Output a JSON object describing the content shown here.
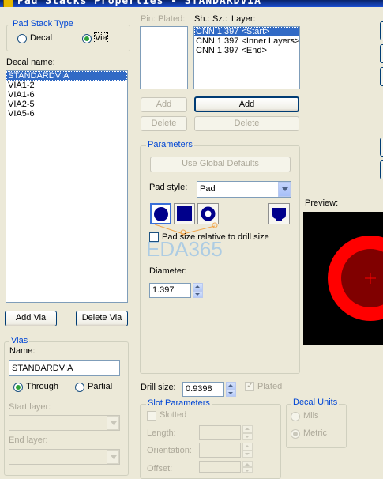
{
  "window": {
    "title": "Pad Stacks Properties - STANDARDVIA"
  },
  "pad_stack_type": {
    "label": "Pad Stack Type",
    "decal": "Decal",
    "via": "Via",
    "selected": "Via"
  },
  "decal_name": {
    "label": "Decal name:",
    "items": [
      "STANDARDVIA",
      "VIA1-2",
      "VIA1-6",
      "VIA2-5",
      "VIA5-6"
    ],
    "selected": "STANDARDVIA"
  },
  "buttons": {
    "add_via": "Add Via",
    "delete_via": "Delete Via",
    "add_left": "Add",
    "delete_left": "Delete",
    "add_right": "Add",
    "delete_right": "Delete"
  },
  "pin_header": {
    "pin": "Pin:",
    "plated": "Plated:"
  },
  "layer_header": {
    "sh": "Sh.:",
    "sz": "Sz.:",
    "layer": "Layer:"
  },
  "layers": {
    "items": [
      "CNN 1.397 <Start>",
      "CNN 1.397 <Inner Layers>",
      "CNN 1.397 <End>"
    ],
    "selected": "CNN 1.397 <Start>"
  },
  "parameters": {
    "label": "Parameters",
    "use_global_defaults": "Use Global Defaults",
    "pad_style_label": "Pad style:",
    "pad_style_value": "Pad",
    "pad_size_relative": "Pad size relative to drill size",
    "diameter_label": "Diameter:",
    "diameter_value": "1.397"
  },
  "preview": {
    "label": "Preview:",
    "pad_color": "#ff0000",
    "hole_color": "#800000"
  },
  "watermark": "EDA365",
  "vias": {
    "label": "Vias",
    "name_label": "Name:",
    "name_value": "STANDARDVIA",
    "through": "Through",
    "partial": "Partial",
    "selected": "Through",
    "start_layer": "Start layer:",
    "end_layer": "End layer:"
  },
  "drill": {
    "label": "Drill size:",
    "value": "0.9398",
    "plated": "Plated"
  },
  "slot": {
    "label": "Slot Parameters",
    "slotted": "Slotted",
    "length": "Length:",
    "orientation": "Orientation:",
    "offset": "Offset:"
  },
  "decal_units": {
    "label": "Decal Units",
    "mils": "Mils",
    "metric": "Metric",
    "selected": "Metric"
  },
  "colors": {
    "selection": "#316ac5",
    "group_label": "#0046d5",
    "pad_icon": "#00008b"
  }
}
